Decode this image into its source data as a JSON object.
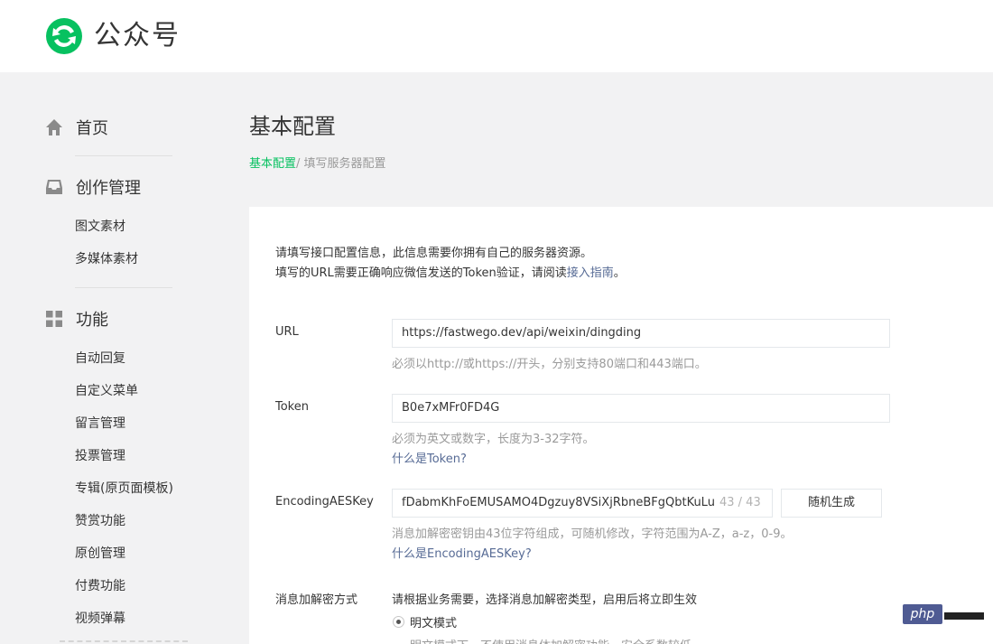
{
  "header": {
    "brand": "公众号"
  },
  "sidebar": {
    "sections": [
      {
        "label": "首页",
        "icon": "home-icon"
      },
      {
        "label": "创作管理",
        "icon": "inbox-icon",
        "items": [
          "图文素材",
          "多媒体素材"
        ]
      },
      {
        "label": "功能",
        "icon": "grid-icon",
        "items": [
          "自动回复",
          "自定义菜单",
          "留言管理",
          "投票管理",
          "专辑(原页面模板)",
          "赞赏功能",
          "原创管理",
          "付费功能",
          "视频弹幕"
        ]
      }
    ]
  },
  "main": {
    "title": "基本配置",
    "breadcrumb": {
      "active": "基本配置",
      "current": "/ 填写服务器配置"
    },
    "intro": {
      "line1": "请填写接口配置信息，此信息需要你拥有自己的服务器资源。",
      "line2_prefix": "填写的URL需要正确响应微信发送的Token验证，请阅读",
      "line2_link": "接入指南",
      "line2_suffix": "。"
    },
    "form": {
      "url": {
        "label": "URL",
        "value": "https://fastwego.dev/api/weixin/dingding",
        "hint": "必须以http://或https://开头，分别支持80端口和443端口。"
      },
      "token": {
        "label": "Token",
        "value": "B0e7xMFr0FD4G",
        "hint": "必须为英文或数字，长度为3-32字符。",
        "link": "什么是Token?"
      },
      "aeskey": {
        "label": "EncodingAESKey",
        "value": "fDabmKhFoEMUSAMO4Dgzuy8VSiXjRbneBFgQbtKuLu",
        "counter": "43 / 43",
        "button": "随机生成",
        "hint": "消息加解密密钥由43位字符组成，可随机修改，字符范围为A-Z，a-z，0-9。",
        "link": "什么是EncodingAESKey?"
      },
      "encrypt": {
        "label": "消息加解密方式",
        "desc": "请根据业务需要，选择消息加解密类型，启用后将立即生效",
        "option": "明文模式",
        "option_desc": "明文模式下，不使用消息体加解密功能，安全系数较低"
      }
    }
  },
  "watermark": {
    "text": "php"
  },
  "colors": {
    "accent": "#07c160",
    "link": "#576b95"
  }
}
